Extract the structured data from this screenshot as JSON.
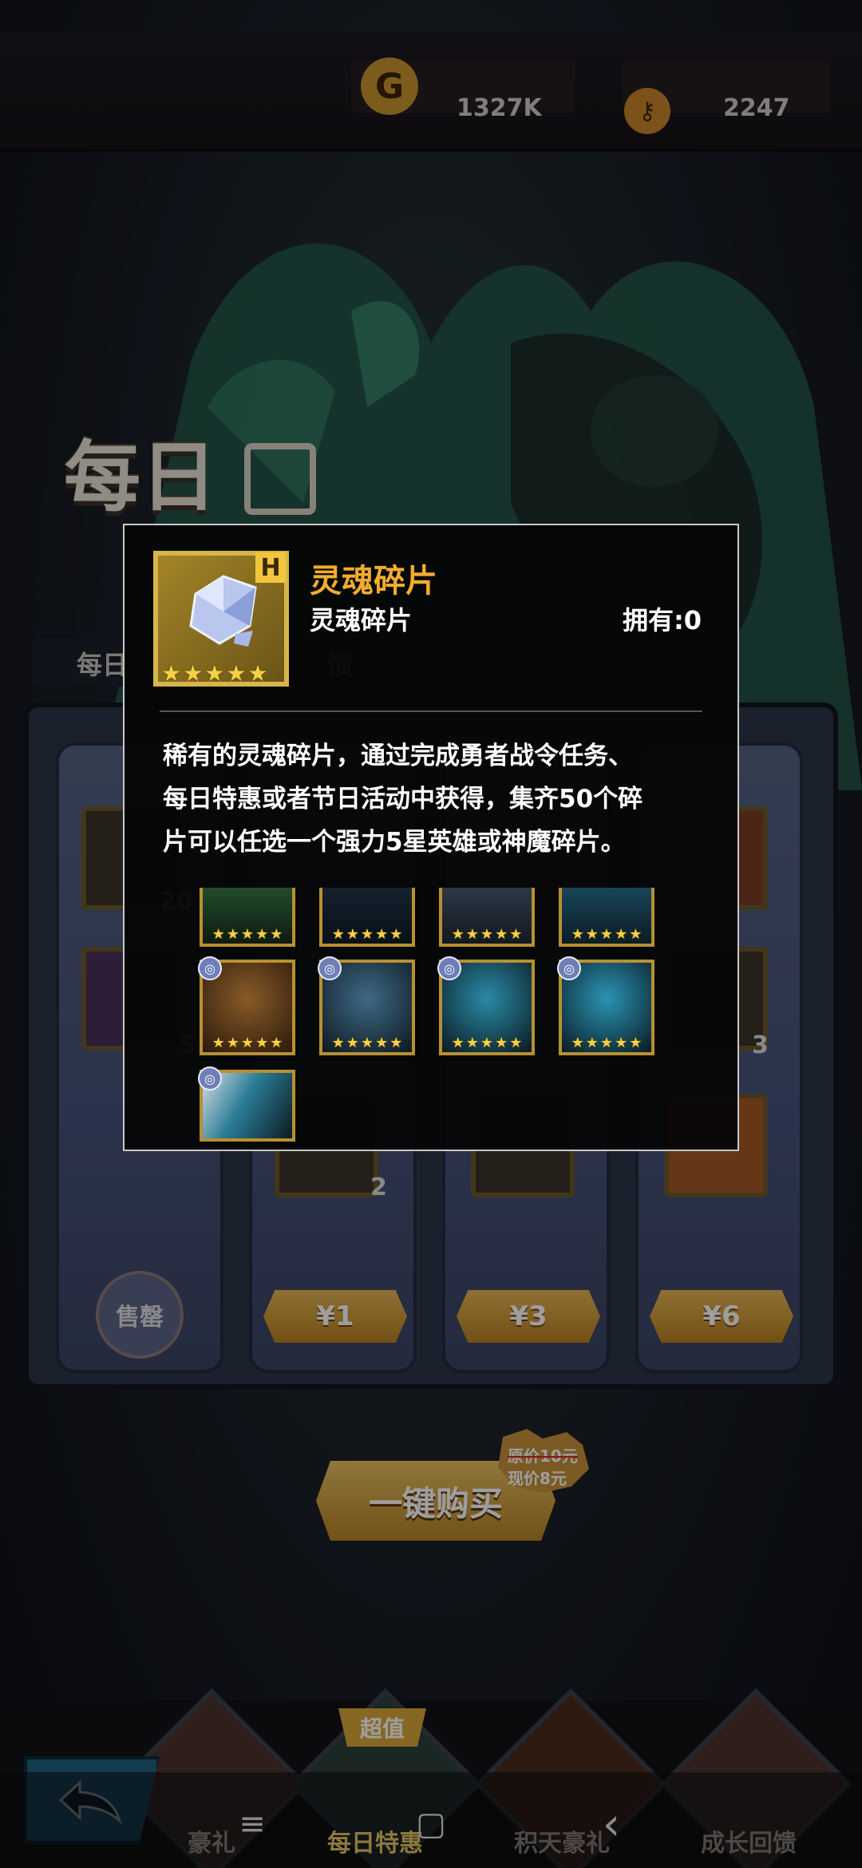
{
  "currency": {
    "gold": {
      "icon": "gold-coin-icon",
      "value": "1327K",
      "color": "#d6a43a"
    },
    "gem": {
      "icon": "key-currency-icon",
      "value": "2247",
      "color": "#d6892a"
    }
  },
  "page": {
    "title": "每日",
    "subtitle": "每日",
    "subtitle_suffix": "馈"
  },
  "shop": {
    "prices": [
      "¥1",
      "¥3",
      "¥6"
    ],
    "soldout_label": "售罄",
    "slot_counts": [
      "20",
      "5",
      "2",
      "3"
    ],
    "buy_all_label": "一键购买",
    "original_price": "原价10元",
    "current_price": "现价8元"
  },
  "bottom_nav": {
    "items": [
      {
        "label": "豪礼",
        "icon": "gift-tab-icon"
      },
      {
        "label": "每日特惠",
        "icon": "daily-deal-tab-icon",
        "badge": "超值"
      },
      {
        "label": "积天豪礼",
        "icon": "accumulate-tab-icon"
      },
      {
        "label": "成长回馈",
        "icon": "growth-tab-icon"
      }
    ]
  },
  "system_nav": {
    "menu": "≡",
    "home": "▢",
    "back": "‹"
  },
  "modal": {
    "item_name": "灵魂碎片",
    "item_type": "灵魂碎片",
    "owned_label": "拥有:0",
    "badge": "H",
    "stars": 5,
    "description": [
      "稀有的灵魂碎片，通过完成勇者战令任务、",
      "每日特惠或者节日活动中获得，集齐50个碎",
      "片可以任选一个强力5星英雄或神魔碎片。"
    ],
    "heroes": [
      {
        "name": "hero-green-dryad",
        "color": "#2e6a3a",
        "stars": 5
      },
      {
        "name": "hero-dark-knight",
        "color": "#1d2c3a",
        "stars": 5
      },
      {
        "name": "hero-armored-beast",
        "color": "#3b4c5c",
        "stars": 5
      },
      {
        "name": "hero-cyan-spirit",
        "color": "#1f5f79",
        "stars": 5
      },
      {
        "name": "hero-forest-witch",
        "color": "#5b3a1e",
        "stars": 5
      },
      {
        "name": "hero-shadow-lancer",
        "color": "#2a3d4d",
        "stars": 5
      },
      {
        "name": "hero-azure-demon",
        "color": "#1c4a5e",
        "stars": 5
      },
      {
        "name": "hero-aqua-hunter",
        "color": "#1b4a63",
        "stars": 5
      },
      {
        "name": "hero-storm-rider",
        "color": "#304050",
        "stars": 5
      }
    ]
  }
}
